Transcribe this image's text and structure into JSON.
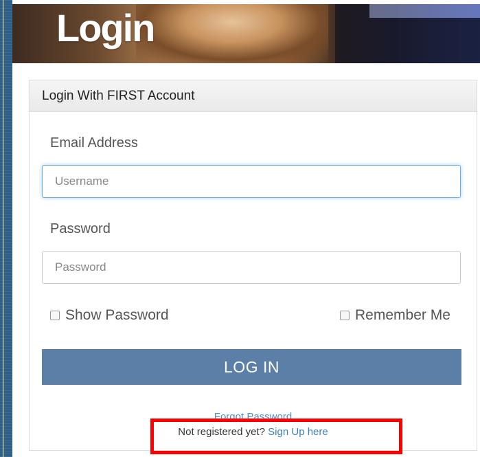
{
  "hero": {
    "title": "Login"
  },
  "panel": {
    "heading": "Login With FIRST Account"
  },
  "email": {
    "label": "Email Address",
    "placeholder": "Username",
    "value": ""
  },
  "password": {
    "label": "Password",
    "placeholder": "Password",
    "value": ""
  },
  "options": {
    "show_password": "Show Password",
    "remember_me": "Remember Me"
  },
  "login_button": {
    "label": "LOG IN"
  },
  "links": {
    "forgot_password": "Forgot Password",
    "not_registered": "Not registered yet?",
    "sign_up": "Sign Up here"
  },
  "colors": {
    "button": "#5b7fa6",
    "link": "#3b7fc4",
    "highlight": "#ff0000"
  }
}
